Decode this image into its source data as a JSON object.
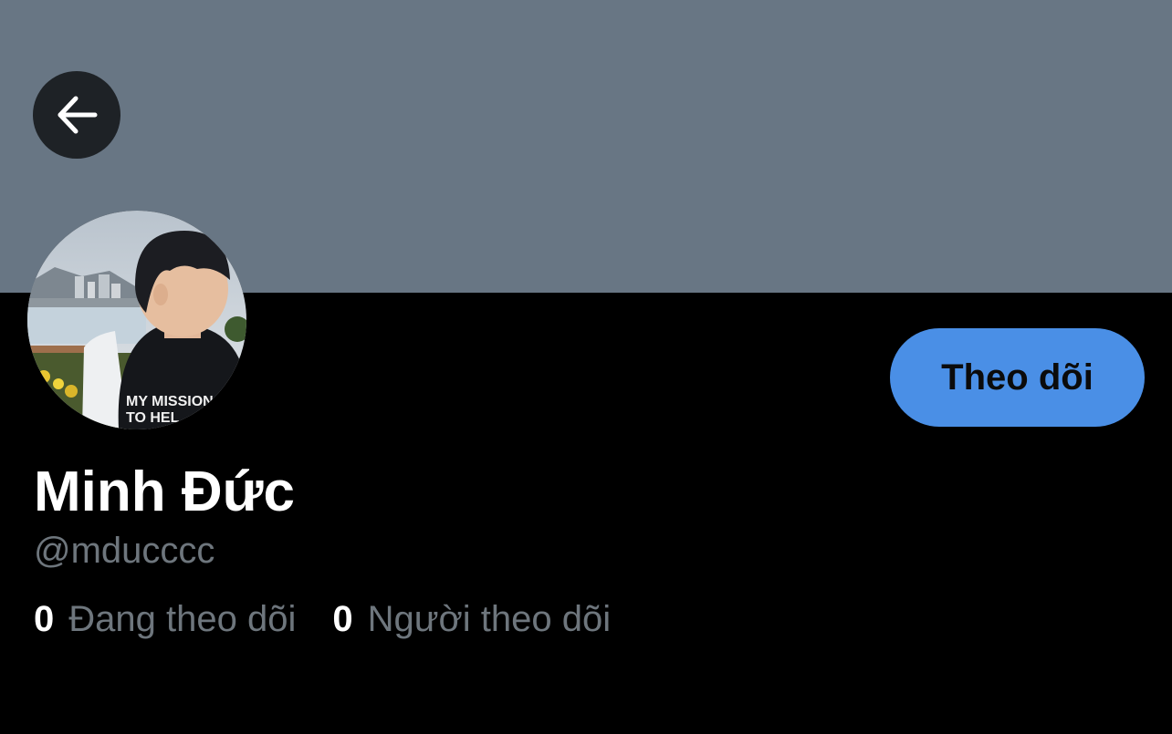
{
  "header": {
    "banner_color": "#687684",
    "back_icon": "arrow-left-icon"
  },
  "profile": {
    "avatar_alt": "profile photo",
    "display_name": "Minh Đức",
    "handle": "@mducccc",
    "follow_button_label": "Theo dõi",
    "follow_button_color": "#4a8fe6"
  },
  "stats": {
    "following_count": "0",
    "following_label": "Đang theo dõi",
    "followers_count": "0",
    "followers_label": "Người theo dõi"
  }
}
